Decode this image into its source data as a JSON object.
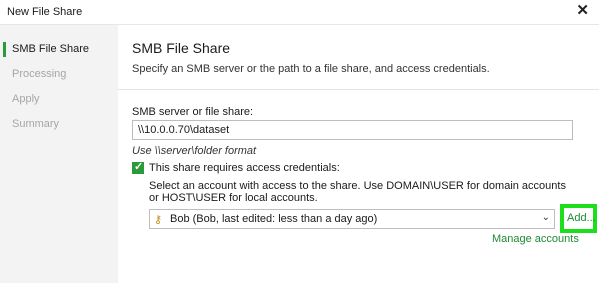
{
  "window": {
    "title": "New File Share",
    "close_glyph": "✕"
  },
  "sidebar": {
    "steps": [
      {
        "label": "SMB File Share",
        "active": true
      },
      {
        "label": "Processing",
        "active": false
      },
      {
        "label": "Apply",
        "active": false
      },
      {
        "label": "Summary",
        "active": false
      }
    ]
  },
  "main": {
    "title": "SMB File Share",
    "description": "Specify an SMB server or the path to a file share, and access credentials.",
    "smb_label": "SMB server or file share:",
    "smb_value": "\\\\10.0.0.70\\dataset",
    "hint": "Use \\\\server\\folder format",
    "credentials_checkbox": {
      "label": "This share requires access credentials:",
      "checked": true
    },
    "account_description": "Select an account with access to the share. Use DOMAIN\\USER for domain accounts or HOST\\USER for local accounts.",
    "account": {
      "selected": "Bob (Bob, last edited: less than a day ago)",
      "icon": "key-icon"
    },
    "add_label": "Add...",
    "manage_label": "Manage accounts"
  },
  "colors": {
    "accent": "#2b9a3a",
    "link": "#1f8a34",
    "highlight": "#1cde1c"
  }
}
